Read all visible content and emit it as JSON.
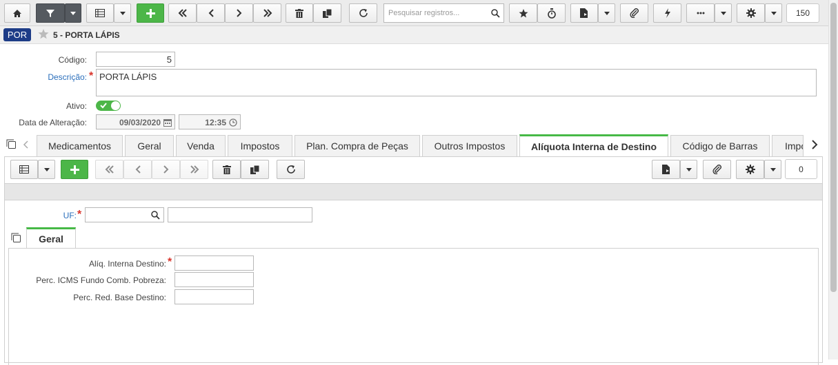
{
  "toolbar": {
    "search_placeholder": "Pesquisar registros...",
    "record_count": "150"
  },
  "header": {
    "badge": "POR",
    "record_title": "5 - PORTA LÁPIS"
  },
  "form": {
    "codigo_label": "Código:",
    "codigo_value": "5",
    "descricao_label": "Descrição:",
    "descricao_value": "PORTA LÁPIS",
    "ativo_label": "Ativo:",
    "ativo_checked": true,
    "data_alteracao_label": "Data de Alteração:",
    "data_value": "09/03/2020",
    "hora_value": "12:35",
    "required_mark": "*"
  },
  "tabs": [
    {
      "label": "Medicamentos"
    },
    {
      "label": "Geral"
    },
    {
      "label": "Venda"
    },
    {
      "label": "Impostos"
    },
    {
      "label": "Plan. Compra de Peças"
    },
    {
      "label": "Outros Impostos"
    },
    {
      "label": "Alíquota Interna de Destino"
    },
    {
      "label": "Código de Barras"
    },
    {
      "label": "Impo"
    }
  ],
  "active_tab": "Alíquota Interna de Destino",
  "subtoolbar": {
    "record_count": "0"
  },
  "detail": {
    "uf_label": "UF:",
    "geral_tab": "Geral",
    "fields": [
      {
        "label": "Alíq. Interna Destino:",
        "required": true
      },
      {
        "label": "Perc. ICMS Fundo Comb. Pobreza:",
        "required": false
      },
      {
        "label": "Perc. Red. Base Destino:",
        "required": false
      }
    ]
  },
  "colors": {
    "accent_green": "#4cb648",
    "badge_blue": "#1d3c87",
    "label_blue": "#2a6ebb",
    "required_red": "#d9342b"
  }
}
